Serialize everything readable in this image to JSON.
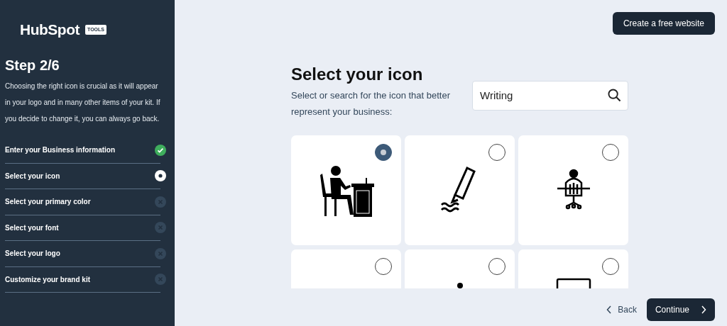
{
  "sidebar": {
    "logo": "HubSpot",
    "logo_badge": "TOOLS",
    "step": "Step 2/6",
    "description": "Choosing the right icon is crucial as it will appear in your logo and in many other items of your kit. If you decide to change it, you can always go back.",
    "steps": [
      {
        "label": "Enter your Business information",
        "kind": "done"
      },
      {
        "label": "Select your icon",
        "kind": "current"
      },
      {
        "label": "Select your primary color",
        "kind": "pending"
      },
      {
        "label": "Select your font",
        "kind": "pending"
      },
      {
        "label": "Select your logo",
        "kind": "pending"
      },
      {
        "label": "Customize your brand kit",
        "kind": "pending"
      }
    ]
  },
  "header": {
    "create_button": "Create a free website"
  },
  "main": {
    "title": "Select your icon",
    "subtitle": "Select or search for the icon that better represent your business:",
    "search": {
      "value": "Writing"
    },
    "icons": [
      {
        "selected": true
      },
      {
        "selected": false
      },
      {
        "selected": false
      },
      {
        "selected": false
      },
      {
        "selected": false
      },
      {
        "selected": false
      }
    ]
  },
  "footer": {
    "back": "Back",
    "continue": "Continue"
  }
}
